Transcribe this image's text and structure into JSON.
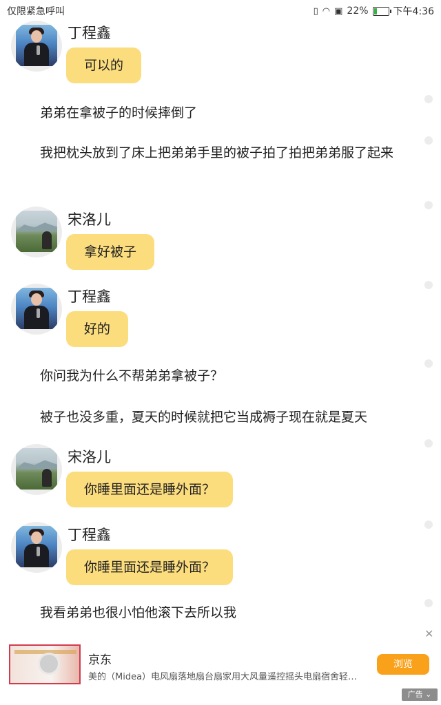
{
  "status_bar": {
    "left_text": "仅限紧急呼叫",
    "battery": "22%",
    "time": "下午4:36",
    "battery_level": 0.22,
    "icons": [
      "vibrate-icon",
      "wifi-icon",
      "battery-saver-icon",
      "battery-icon"
    ]
  },
  "chat": [
    {
      "type": "message",
      "name": "丁程鑫",
      "avatar": "avatar-ding-chengxin",
      "text": "可以的"
    },
    {
      "type": "narration",
      "text": "弟弟在拿被子的时候摔倒了"
    },
    {
      "type": "narration",
      "text": "我把枕头放到了床上把弟弟手里的被子拍了拍把弟弟服了起来"
    },
    {
      "type": "message",
      "name": "宋洛儿",
      "avatar": "avatar-song-luoer",
      "text": "拿好被子"
    },
    {
      "type": "message",
      "name": "丁程鑫",
      "avatar": "avatar-ding-chengxin",
      "text": "好的"
    },
    {
      "type": "narration",
      "text": "你问我为什么不帮弟弟拿被子？"
    },
    {
      "type": "narration",
      "text": "被子也没多重，夏天的时候就把它当成褥子现在就是夏天"
    },
    {
      "type": "message",
      "name": "宋洛儿",
      "avatar": "avatar-song-luoer",
      "text": "你睡里面还是睡外面？"
    },
    {
      "type": "message",
      "name": "丁程鑫",
      "avatar": "avatar-ding-chengxin",
      "text": "你睡里面还是睡外面？"
    },
    {
      "type": "narration",
      "text": "我看弟弟也很小怕他滚下去所以我"
    }
  ],
  "ad": {
    "brand": "京东",
    "description": "美的（Midea）电风扇落地扇台扇家用大风量遥控摇头电扇宿舍轻音低噪...",
    "button_label": "浏览",
    "tag": "广告",
    "close_icon": "close-icon"
  },
  "colors": {
    "bubble": "#fcdd7e",
    "ad_button": "#f9a11b",
    "avatar_ring": "#ececec"
  }
}
